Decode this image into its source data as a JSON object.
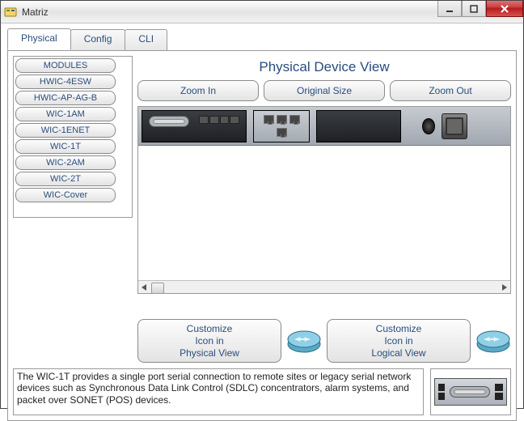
{
  "window": {
    "title": "Matriz"
  },
  "tabs": [
    {
      "label": "Physical",
      "active": true
    },
    {
      "label": "Config",
      "active": false
    },
    {
      "label": "CLI",
      "active": false
    }
  ],
  "modules": {
    "header": "MODULES",
    "items": [
      "HWIC-4ESW",
      "HWIC-AP-AG-B",
      "WIC-1AM",
      "WIC-1ENET",
      "WIC-1T",
      "WIC-2AM",
      "WIC-2T",
      "WIC-Cover"
    ]
  },
  "physical_view": {
    "title": "Physical Device View",
    "zoom_in": "Zoom In",
    "original_size": "Original Size",
    "zoom_out": "Zoom Out"
  },
  "customize": {
    "physical": "Customize\nIcon in\nPhysical View",
    "logical": "Customize\nIcon in\nLogical View"
  },
  "description": "The WIC-1T provides a single port serial connection to remote sites or legacy serial network devices such as Synchronous Data Link Control (SDLC) concentrators, alarm systems, and packet over SONET (POS) devices."
}
